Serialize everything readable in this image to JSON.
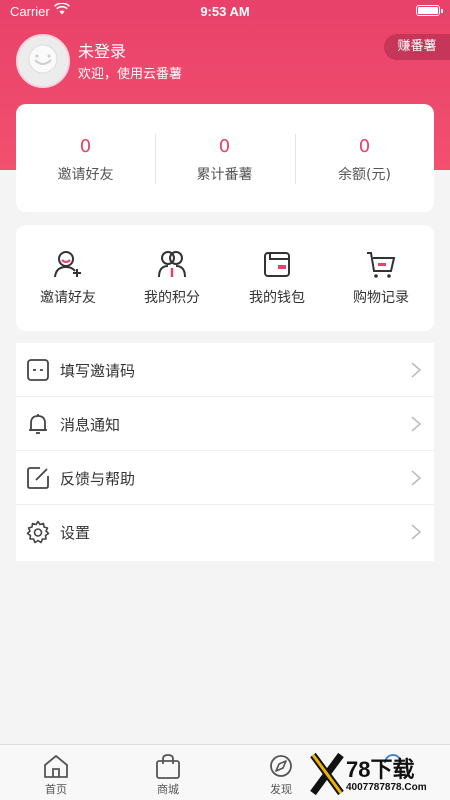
{
  "status_bar": {
    "carrier": "Carrier",
    "time": "9:53 AM"
  },
  "profile": {
    "name": "未登录",
    "subtitle": "欢迎，使用云番薯"
  },
  "earn_button": "赚番薯",
  "stats": [
    {
      "value": "0",
      "label": "邀请好友"
    },
    {
      "value": "0",
      "label": "累计番薯"
    },
    {
      "value": "0",
      "label": "余额(元)"
    }
  ],
  "quick_actions": [
    {
      "label": "邀请好友",
      "icon": "invite-friend-icon"
    },
    {
      "label": "我的积分",
      "icon": "points-icon"
    },
    {
      "label": "我的钱包",
      "icon": "wallet-icon"
    },
    {
      "label": "购物记录",
      "icon": "shopping-cart-icon"
    }
  ],
  "menu": [
    {
      "label": "填写邀请码",
      "icon": "invite-code-icon"
    },
    {
      "label": "消息通知",
      "icon": "bell-icon"
    },
    {
      "label": "反馈与帮助",
      "icon": "feedback-icon"
    },
    {
      "label": "设置",
      "icon": "gear-icon"
    }
  ],
  "tabs": [
    {
      "label": "首页",
      "icon": "home-icon"
    },
    {
      "label": "商城",
      "icon": "shop-bag-icon"
    },
    {
      "label": "发现",
      "icon": "discover-icon"
    },
    {
      "label": "",
      "icon": "profile-icon"
    }
  ],
  "watermark": {
    "main": "78下载",
    "sub": "4007787878.Com"
  },
  "colors": {
    "accent": "#e8416a",
    "accent_dark": "#c53658"
  }
}
